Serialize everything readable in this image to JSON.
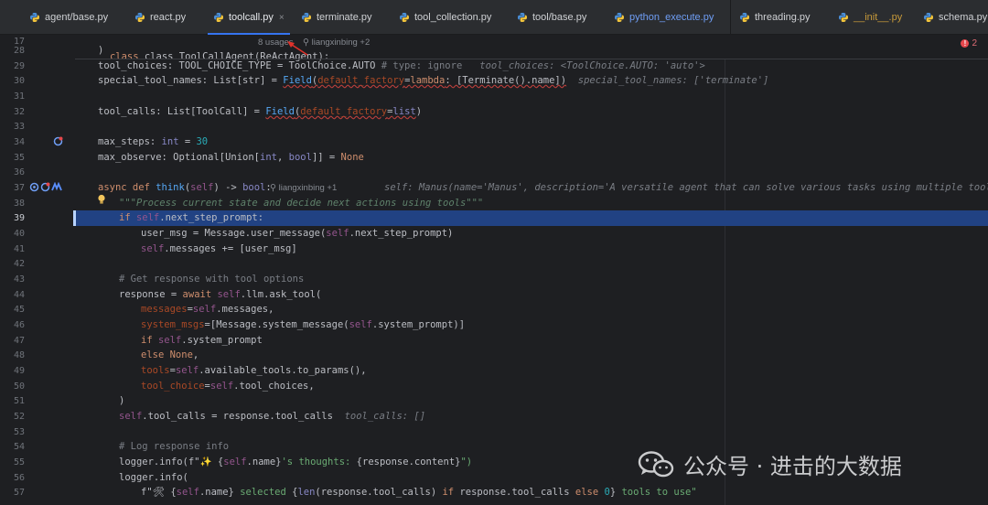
{
  "tabs": [
    {
      "label": "agent/base.py",
      "state": "normal"
    },
    {
      "label": "react.py",
      "state": "normal"
    },
    {
      "label": "toolcall.py",
      "state": "active",
      "close": "×"
    },
    {
      "label": "terminate.py",
      "state": "normal"
    },
    {
      "label": "tool_collection.py",
      "state": "normal"
    },
    {
      "label": "tool/base.py",
      "state": "normal"
    },
    {
      "label": "python_execute.py",
      "state": "modified"
    },
    {
      "label": "threading.py",
      "state": "normal"
    },
    {
      "label": "__init__.py",
      "state": "warning"
    },
    {
      "label": "schema.py",
      "state": "normal"
    }
  ],
  "sticky": {
    "line": "17",
    "code": "class ToolCallAgent(ReActAgent):",
    "usages": "8 usages",
    "author": "liangxinbing +2"
  },
  "problems": {
    "count": "2"
  },
  "lines": [
    {
      "n": "28",
      "html_key": "l28"
    },
    {
      "n": "29"
    },
    {
      "n": "30"
    },
    {
      "n": "31"
    },
    {
      "n": "32"
    },
    {
      "n": "33"
    },
    {
      "n": "34"
    },
    {
      "n": "35"
    },
    {
      "n": "36"
    },
    {
      "n": "37"
    },
    {
      "n": "38"
    },
    {
      "n": "39"
    },
    {
      "n": "40"
    },
    {
      "n": "41"
    },
    {
      "n": "42"
    },
    {
      "n": "43"
    },
    {
      "n": "44"
    },
    {
      "n": "45"
    },
    {
      "n": "46"
    },
    {
      "n": "47"
    },
    {
      "n": "48"
    },
    {
      "n": "49"
    },
    {
      "n": "50"
    },
    {
      "n": "51"
    },
    {
      "n": "52"
    },
    {
      "n": "53"
    },
    {
      "n": "54"
    },
    {
      "n": "55"
    },
    {
      "n": "56"
    },
    {
      "n": "57"
    }
  ],
  "code": {
    "l28": ")",
    "l29_a": "tool_choices: TOOL_CHOICE_TYPE = ToolChoice.AUTO ",
    "l29_cmt": "# type: ignore",
    "l29_hint": "tool_choices: <ToolChoice.AUTO: 'auto'>",
    "l30_a": "special_tool_names: List[str] = ",
    "l30_field": "Field",
    "l30_b": "(",
    "l30_param": "default_factory",
    "l30_c": "=",
    "l30_kw": "lambda",
    "l30_d": ": [Terminate().name])",
    "l30_hint": "special_tool_names: ['terminate']",
    "l32_a": "tool_calls: List[ToolCall] = ",
    "l32_field": "Field",
    "l32_b": "(",
    "l32_param": "default_factory",
    "l32_c": "=",
    "l32_builtin": "list",
    "l32_d": ")",
    "l34_a": "max_steps: ",
    "l34_type": "int",
    "l34_b": " = ",
    "l34_num": "30",
    "l35_a": "max_observe: Optional[Union[",
    "l35_int": "int",
    "l35_b": ", ",
    "l35_bool": "bool",
    "l35_c": "]] = ",
    "l35_none": "None",
    "l37_kw": "async def ",
    "l37_fn": "think",
    "l37_a": "(",
    "l37_self": "self",
    "l37_b": ") -> ",
    "l37_bool": "bool",
    "l37_c": ":",
    "l37_author": "liangxinbing +1",
    "l37_hint": "self: Manus(name='Manus', description='A versatile agent that can solve various tasks using multiple tools', sys",
    "l38_doc": "\"\"\"Process current state and decide next actions using tools\"\"\"",
    "l39_kw": "if ",
    "l39_self": "self",
    "l39_a": ".next_step_prompt:",
    "l40_a": "user_msg = Message.user_message(",
    "l40_self": "self",
    "l40_b": ".next_step_prompt)",
    "l41_self": "self",
    "l41_a": ".messages += [user_msg]",
    "l43_cmt": "# Get response with tool options",
    "l44_a": "response = ",
    "l44_kw": "await ",
    "l44_self": "self",
    "l44_b": ".llm.ask_tool(",
    "l45_param": "messages",
    "l45_a": "=",
    "l45_self": "self",
    "l45_b": ".messages,",
    "l46_param": "system_msgs",
    "l46_a": "=[Message.system_message(",
    "l46_self": "self",
    "l46_b": ".system_prompt)]",
    "l47_kw": "if ",
    "l47_self": "self",
    "l47_a": ".system_prompt",
    "l48_kw": "else ",
    "l48_none": "None",
    "l48_a": ",",
    "l49_param": "tools",
    "l49_a": "=",
    "l49_self": "self",
    "l49_b": ".available_tools.to_params(),",
    "l50_param": "tool_choice",
    "l50_a": "=",
    "l50_self": "self",
    "l50_b": ".tool_choices,",
    "l51_a": ")",
    "l52_self": "self",
    "l52_a": ".tool_calls = response.tool_calls",
    "l52_hint": "tool_calls: []",
    "l54_cmt": "# Log response info",
    "l55_a": "logger.info(f\"",
    "l55_emoji": "✨",
    "l55_b": " {",
    "l55_self": "self",
    "l55_c": ".name}",
    "l55_str": "'s thoughts: ",
    "l55_d": "{response.content}",
    "l55_e": "\")",
    "l56_a": "logger.info(",
    "l57_a": "f\"",
    "l57_emoji": "🛠",
    "l57_b": " {",
    "l57_self": "self",
    "l57_c": ".name}",
    "l57_str1": " selected ",
    "l57_d": "{",
    "l57_len": "len",
    "l57_e": "(response.tool_calls) ",
    "l57_kw1": "if ",
    "l57_f": "response.tool_calls ",
    "l57_kw2": "else ",
    "l57_num": "0",
    "l57_g": "}",
    "l57_str2": " tools to use\""
  },
  "watermark": {
    "text": "公众号 · 进击的大数据"
  },
  "colors": {
    "accent": "#3574f0",
    "selection": "#214283",
    "background": "#1e1f22"
  }
}
